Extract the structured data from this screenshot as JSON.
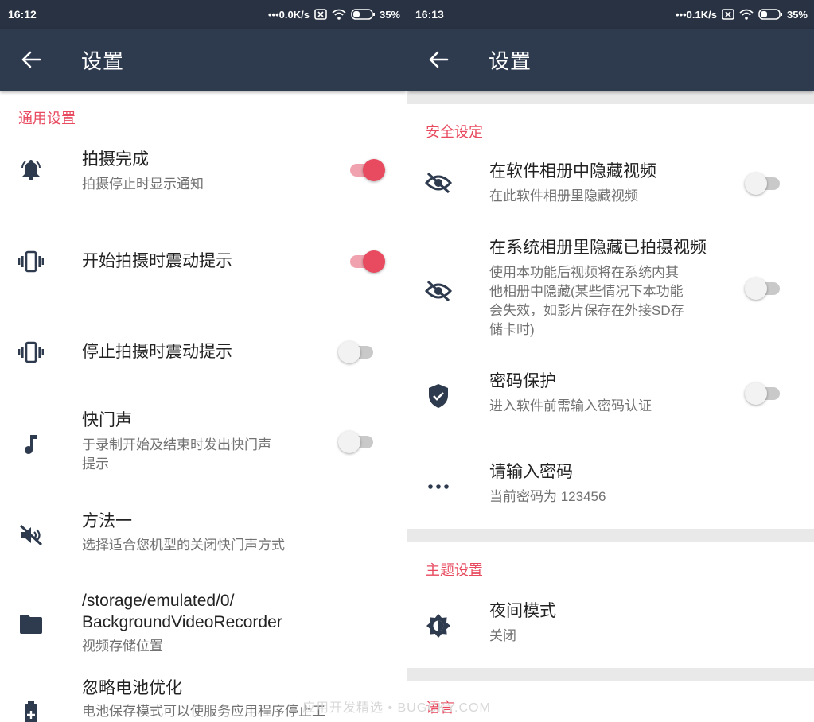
{
  "left": {
    "status": {
      "time": "16:12",
      "speed": "•••0.0K/s",
      "battery": "35%"
    },
    "appbar": {
      "title": "设置"
    },
    "section_general": "通用设置",
    "items": [
      {
        "title": "拍摄完成",
        "summary": "拍摄停止时显示通知",
        "switch": "on",
        "icon": "bell-ring-icon"
      },
      {
        "title": "开始拍摄时震动提示",
        "switch": "on",
        "icon": "vibrate-icon"
      },
      {
        "title": "停止拍摄时震动提示",
        "switch": "off",
        "icon": "vibrate-icon"
      },
      {
        "title": "快门声",
        "summary_line1": "于录制开始及结束时发出快门声",
        "summary_line2": "提示",
        "switch": "off",
        "icon": "music-note-icon"
      },
      {
        "title": "方法一",
        "summary": "选择适合您机型的关闭快门声方式",
        "icon": "volume-off-icon"
      },
      {
        "title_line1": "/storage/emulated/0/",
        "title_line2": "BackgroundVideoRecorder",
        "summary": "视频存储位置",
        "icon": "folder-icon"
      },
      {
        "title": "忽略电池优化",
        "summary": "电池保存模式可以使服务应用程序停止工",
        "icon": "battery-plus-icon"
      }
    ]
  },
  "right": {
    "status": {
      "time": "16:13",
      "speed": "•••0.1K/s",
      "battery": "35%"
    },
    "appbar": {
      "title": "设置"
    },
    "section_security": "安全设定",
    "items": [
      {
        "title": "在软件相册中隐藏视频",
        "summary": "在此软件相册里隐藏视频",
        "switch": "off",
        "icon": "eye-off-icon"
      },
      {
        "title": "在系统相册里隐藏已拍摄视频",
        "summary_line1": "使用本功能后视频将在系统内其",
        "summary_line2": "他相册中隐藏(某些情况下本功能",
        "summary_line3": "会失效，如影片保存在外接SD存",
        "summary_line4": "储卡时)",
        "switch": "off",
        "icon": "eye-off-icon"
      },
      {
        "title": "密码保护",
        "summary": "进入软件前需输入密码认证",
        "switch": "off",
        "icon": "shield-check-icon"
      },
      {
        "title": "请输入密码",
        "summary": "当前密码为 123456",
        "icon": "dots-icon"
      }
    ],
    "section_theme": "主题设置",
    "night_mode": {
      "title": "夜间模式",
      "summary": "关闭",
      "icon": "brightness-icon"
    },
    "section_language": "语言"
  },
  "watermark": "应用开发精选 • BUGCKY.COM",
  "colors": {
    "accent": "#e84a5f",
    "appbar": "#2e3a4e",
    "statusbar": "#283243"
  }
}
